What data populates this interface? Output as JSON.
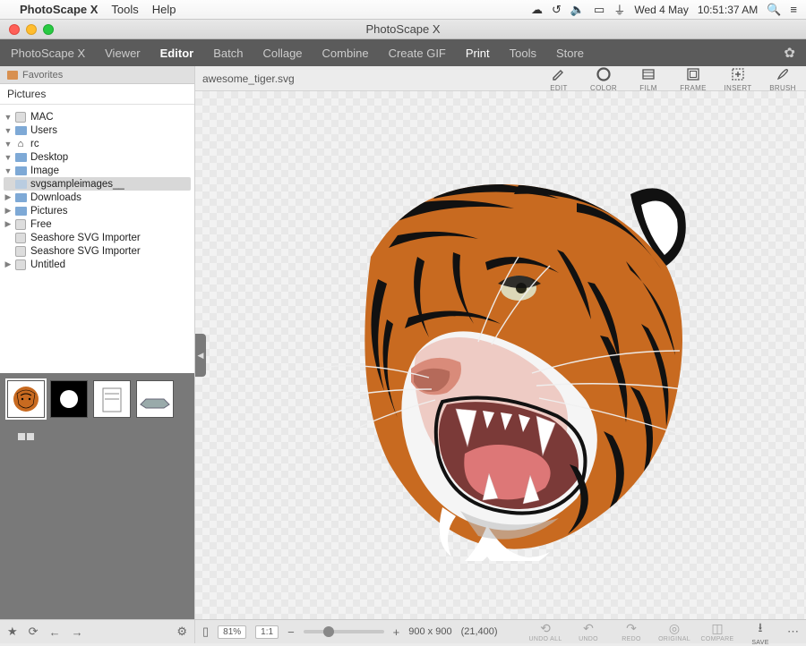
{
  "mac_menu": {
    "app": "PhotoScape X",
    "items": [
      "Tools",
      "Help"
    ],
    "date": "Wed 4 May",
    "time": "10:51:37 AM"
  },
  "window": {
    "title": "PhotoScape X"
  },
  "tabs": {
    "items": [
      "PhotoScape X",
      "Viewer",
      "Editor",
      "Batch",
      "Collage",
      "Combine",
      "Create GIF",
      "Print",
      "Tools",
      "Store"
    ],
    "active": "Editor",
    "print_white": "Print"
  },
  "sidebar": {
    "favorites_label": "Favorites",
    "pictures_label": "Pictures",
    "tree": [
      {
        "indent": 0,
        "expand": "down",
        "icon": "disk",
        "label": "MAC"
      },
      {
        "indent": 1,
        "expand": "down",
        "icon": "folder",
        "label": "Users"
      },
      {
        "indent": 2,
        "expand": "down",
        "icon": "home",
        "label": "rc"
      },
      {
        "indent": 3,
        "expand": "down",
        "icon": "folder",
        "label": "Desktop"
      },
      {
        "indent": 4,
        "expand": "down",
        "icon": "folder",
        "label": "Image"
      },
      {
        "indent": 5,
        "expand": "none",
        "icon": "folder-lt",
        "label": "svgsampleimages__",
        "selected": true
      },
      {
        "indent": 3,
        "expand": "right",
        "icon": "folder",
        "label": "Downloads"
      },
      {
        "indent": 3,
        "expand": "right",
        "icon": "folder",
        "label": "Pictures"
      },
      {
        "indent": 0,
        "expand": "right",
        "icon": "disk",
        "label": "Free"
      },
      {
        "indent": 0,
        "expand": "none",
        "icon": "disk",
        "label": "Seashore SVG Importer"
      },
      {
        "indent": 0,
        "expand": "none",
        "icon": "disk",
        "label": "Seashore SVG Importer"
      },
      {
        "indent": 0,
        "expand": "right",
        "icon": "disk",
        "label": "Untitled"
      }
    ]
  },
  "canvas": {
    "filename": "awesome_tiger.svg",
    "tools": [
      {
        "name": "edit",
        "label": "EDIT"
      },
      {
        "name": "color",
        "label": "COLOR"
      },
      {
        "name": "film",
        "label": "FILM"
      },
      {
        "name": "frame",
        "label": "FRAME"
      },
      {
        "name": "insert",
        "label": "INSERT"
      },
      {
        "name": "brush",
        "label": "BRUSH"
      }
    ]
  },
  "status": {
    "zoom_pct": "81%",
    "zoom_ratio": "1:1",
    "dimensions": "900 x 900",
    "filesize": "(21,400)",
    "right_buttons": [
      {
        "name": "undo-all",
        "label": "UNDO ALL"
      },
      {
        "name": "undo",
        "label": "UNDO"
      },
      {
        "name": "redo",
        "label": "REDO"
      },
      {
        "name": "original",
        "label": "ORIGINAL"
      },
      {
        "name": "compare",
        "label": "COMPARE"
      },
      {
        "name": "save",
        "label": "SAVE",
        "active": true
      }
    ]
  }
}
